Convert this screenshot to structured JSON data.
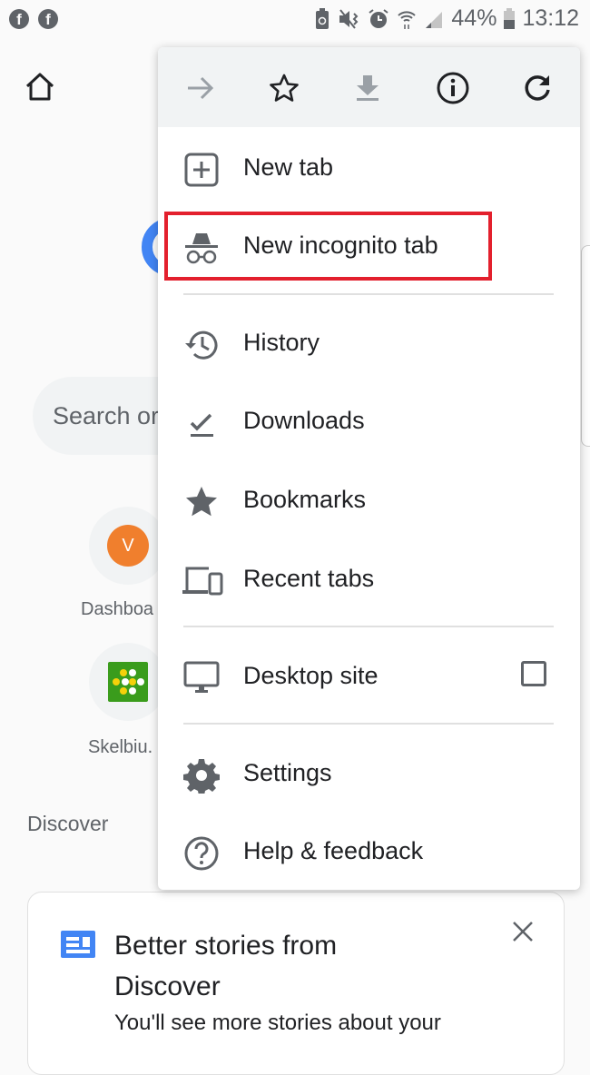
{
  "status_bar": {
    "notifications": [
      "facebook-icon",
      "facebook-icon"
    ],
    "system_icons": [
      "battery-saver-icon",
      "vibrate-mute-icon",
      "alarm-icon",
      "wifi-icon",
      "signal-icon"
    ],
    "battery_percent": "44%",
    "time": "13:12"
  },
  "page": {
    "search_placeholder": "Search or type web address",
    "search_visible_text": "Search or",
    "shortcuts": [
      {
        "label": "Dashboa",
        "icon_letter": "V",
        "color": "#f07f2d"
      },
      {
        "label": "Skelbiu.",
        "icon": "skelbiu-logo",
        "color": "#3a9c1c"
      }
    ],
    "discover_heading": "Discover",
    "card": {
      "title": "Better stories from Discover",
      "body": "You'll see more stories about your"
    }
  },
  "menu": {
    "toolbar": [
      {
        "name": "forward",
        "icon": "arrow-forward-icon",
        "enabled": false
      },
      {
        "name": "bookmark",
        "icon": "star-outline-icon",
        "enabled": true
      },
      {
        "name": "download",
        "icon": "download-icon",
        "enabled": false
      },
      {
        "name": "page-info",
        "icon": "info-icon",
        "enabled": true
      },
      {
        "name": "reload",
        "icon": "reload-icon",
        "enabled": true
      }
    ],
    "items": [
      {
        "label": "New tab",
        "icon": "new-tab-icon"
      },
      {
        "label": "New incognito tab",
        "icon": "incognito-icon",
        "highlighted": true
      },
      {
        "label": "History",
        "icon": "history-icon"
      },
      {
        "label": "Downloads",
        "icon": "downloads-icon"
      },
      {
        "label": "Bookmarks",
        "icon": "bookmarks-icon"
      },
      {
        "label": "Recent tabs",
        "icon": "recent-tabs-icon"
      },
      {
        "label": "Desktop site",
        "icon": "desktop-icon",
        "checked": false
      },
      {
        "label": "Settings",
        "icon": "gear-icon"
      },
      {
        "label": "Help & feedback",
        "icon": "help-icon"
      }
    ],
    "highlight_color": "#e3202d"
  }
}
